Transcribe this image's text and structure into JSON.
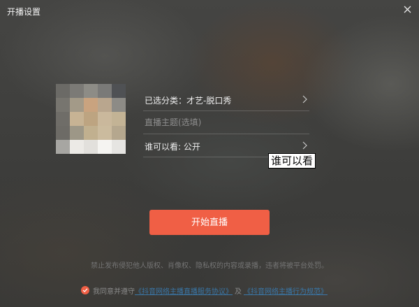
{
  "window": {
    "title": "开播设置"
  },
  "icons": {
    "close": "close-icon",
    "chevron": "chevron-right-icon",
    "check": "check-circle-icon"
  },
  "avatar": {
    "pixels": [
      [
        "#6b6a66",
        "#7b7a76",
        "#8d8c86",
        "#7a7a78",
        "#4f5154"
      ],
      [
        "#77756f",
        "#a39a88",
        "#c9a37f",
        "#b9a68e",
        "#8d8b86"
      ],
      [
        "#6f6d68",
        "#c7b394",
        "#bda481",
        "#cab89c",
        "#c3b395"
      ],
      [
        "#6d6b66",
        "#9d9787",
        "#c1b08f",
        "#cbbb9e",
        "#b5a78e"
      ],
      [
        "#a7a6a2",
        "#eceae6",
        "#e2e0dc",
        "#f5f4f1",
        "#e6e5e2"
      ]
    ]
  },
  "settings": {
    "category_label": "已选分类：才艺-脱口秀",
    "topic_placeholder": "直播主题(选填)",
    "topic_value": "",
    "visibility_label": "谁可以看: 公开"
  },
  "tooltip": {
    "text": "谁可以看"
  },
  "actions": {
    "start_label": "开始直播"
  },
  "footer": {
    "warning": "禁止发布侵犯他人版权、肖像权、隐私权的内容或录播，违者将被平台处罚。",
    "agree_prefix": "我同意并遵守",
    "link1": "《抖音网络主播直播服务协议》",
    "and": "及",
    "link2": "《抖音网络主播行为规范》"
  },
  "colors": {
    "accent": "#f05f45",
    "link": "#3a77a8",
    "text": "#f0f0f0"
  }
}
